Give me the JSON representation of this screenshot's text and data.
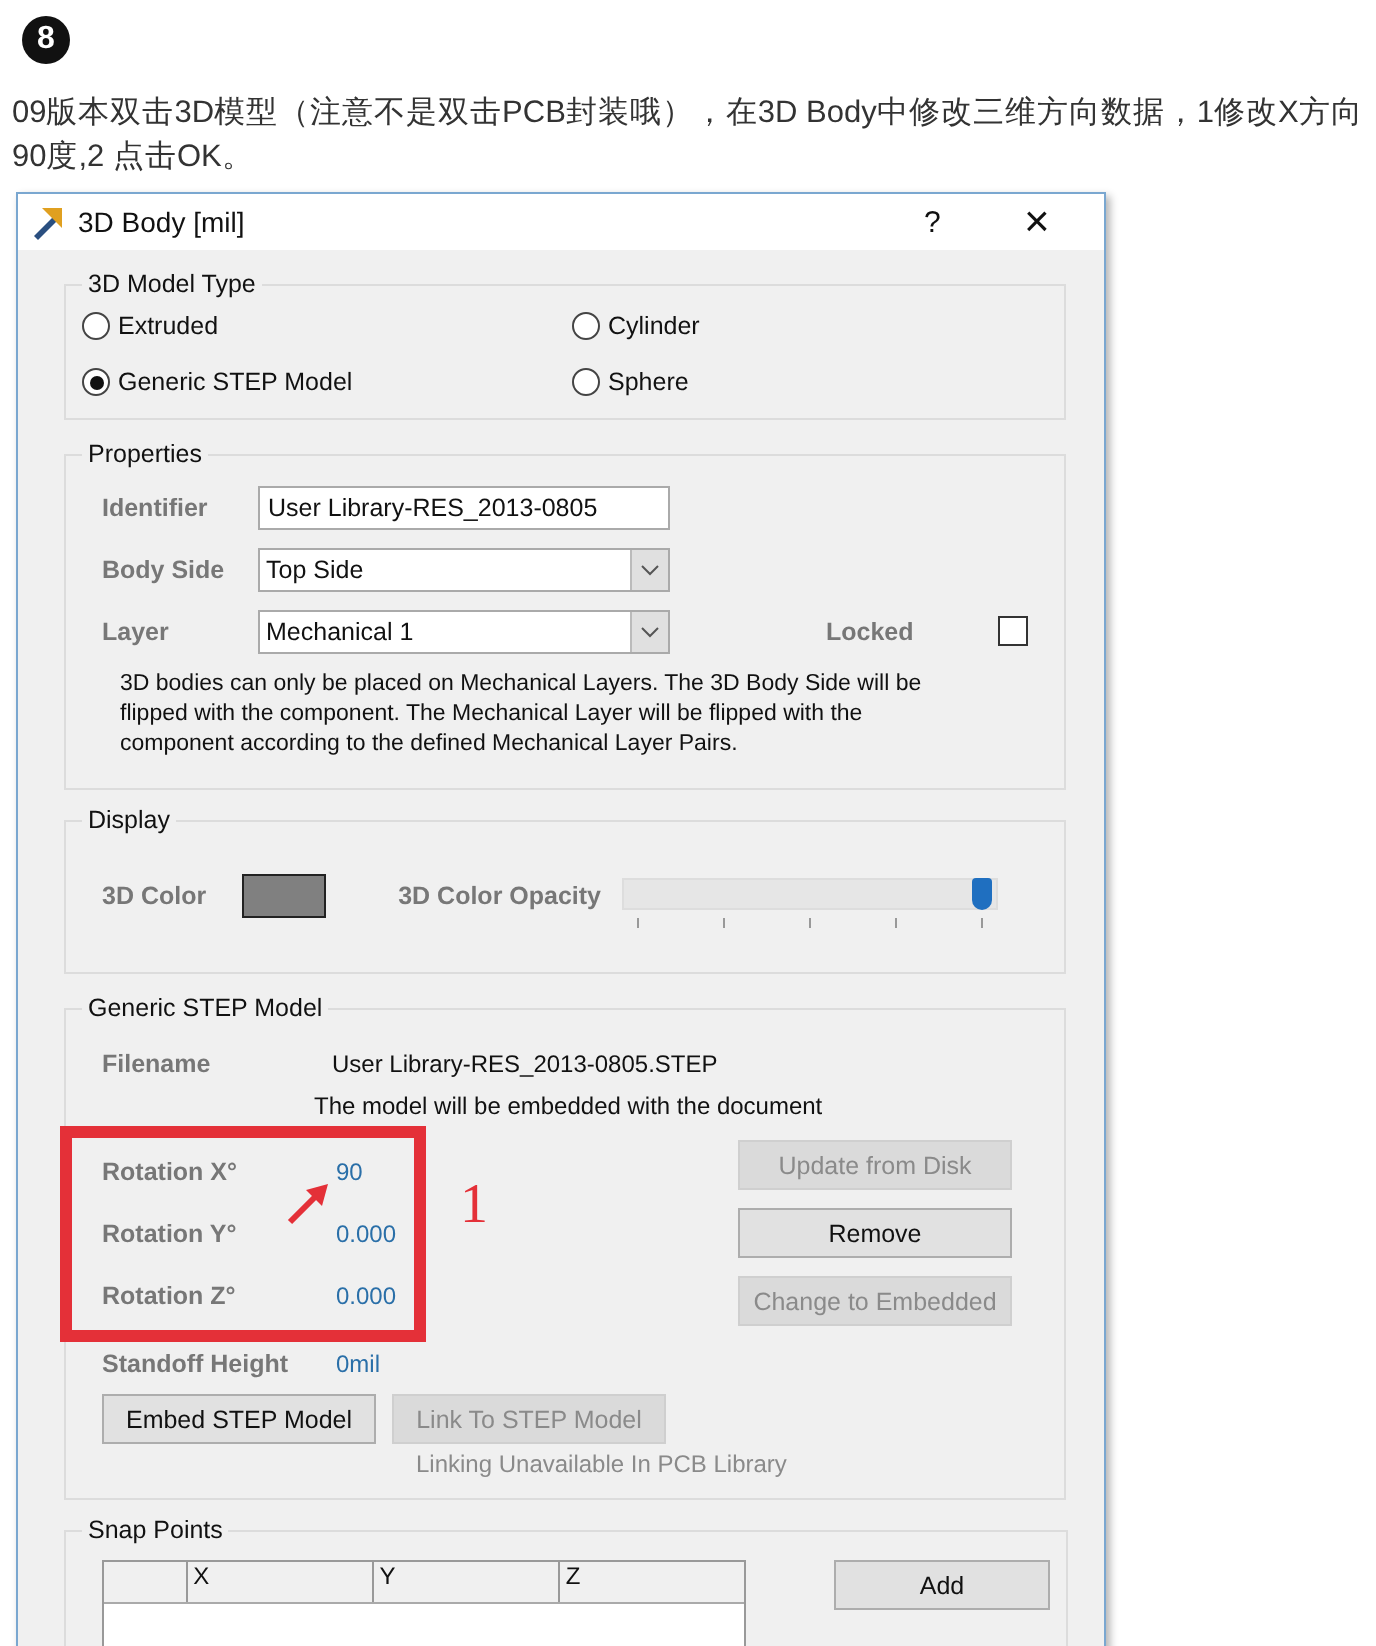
{
  "step_badge": "8",
  "instruction": "09版本双击3D模型（注意不是双击PCB封装哦），在3D Body中修改三维方向数据，1修改X方向90度,2 点击OK。",
  "window": {
    "title": "3D Body [mil]",
    "help": "?",
    "close": "×"
  },
  "model_type": {
    "title": "3D Model Type",
    "options": [
      {
        "label": "Extruded",
        "selected": false
      },
      {
        "label": "Cylinder",
        "selected": false
      },
      {
        "label": "Generic STEP Model",
        "selected": true
      },
      {
        "label": "Sphere",
        "selected": false
      }
    ]
  },
  "properties": {
    "title": "Properties",
    "identifier": {
      "label": "Identifier",
      "value": "User Library-RES_2013-0805"
    },
    "body_side": {
      "label": "Body Side",
      "value": "Top Side"
    },
    "layer": {
      "label": "Layer",
      "value": "Mechanical 1"
    },
    "locked": {
      "label": "Locked",
      "checked": false
    },
    "note": "3D bodies can only be placed on Mechanical Layers. The 3D Body Side will be flipped with the component. The Mechanical Layer will be flipped with the component according to the defined Mechanical Layer Pairs."
  },
  "display": {
    "title": "Display",
    "color_label": "3D Color",
    "color": "#808080",
    "opacity_label": "3D Color Opacity",
    "opacity": {
      "level": 1
    }
  },
  "step_model": {
    "title": "Generic STEP Model",
    "filename_label": "Filename",
    "filename": "User Library-RES_2013-0805.STEP",
    "embed_note": "The model will be embedded with the document",
    "rotations": [
      {
        "label": "Rotation X°",
        "value": "90"
      },
      {
        "label": "Rotation Y°",
        "value": "0.000"
      },
      {
        "label": "Rotation Z°",
        "value": "0.000"
      }
    ],
    "standoff": {
      "label": "Standoff Height",
      "value": "0mil"
    },
    "side_buttons": [
      {
        "label": "Update from Disk",
        "disabled": true
      },
      {
        "label": "Remove",
        "disabled": false
      },
      {
        "label": "Change to Embedded",
        "disabled": true
      }
    ],
    "bottom_buttons": [
      {
        "label": "Embed STEP Model",
        "disabled": false
      },
      {
        "label": "Link To STEP Model",
        "disabled": true
      }
    ],
    "link_note": "Linking Unavailable In PCB Library"
  },
  "snap_points": {
    "title": "Snap Points",
    "columns": [
      "X",
      "Y",
      "Z"
    ],
    "add": "Add"
  },
  "annotation": {
    "label": "1"
  }
}
